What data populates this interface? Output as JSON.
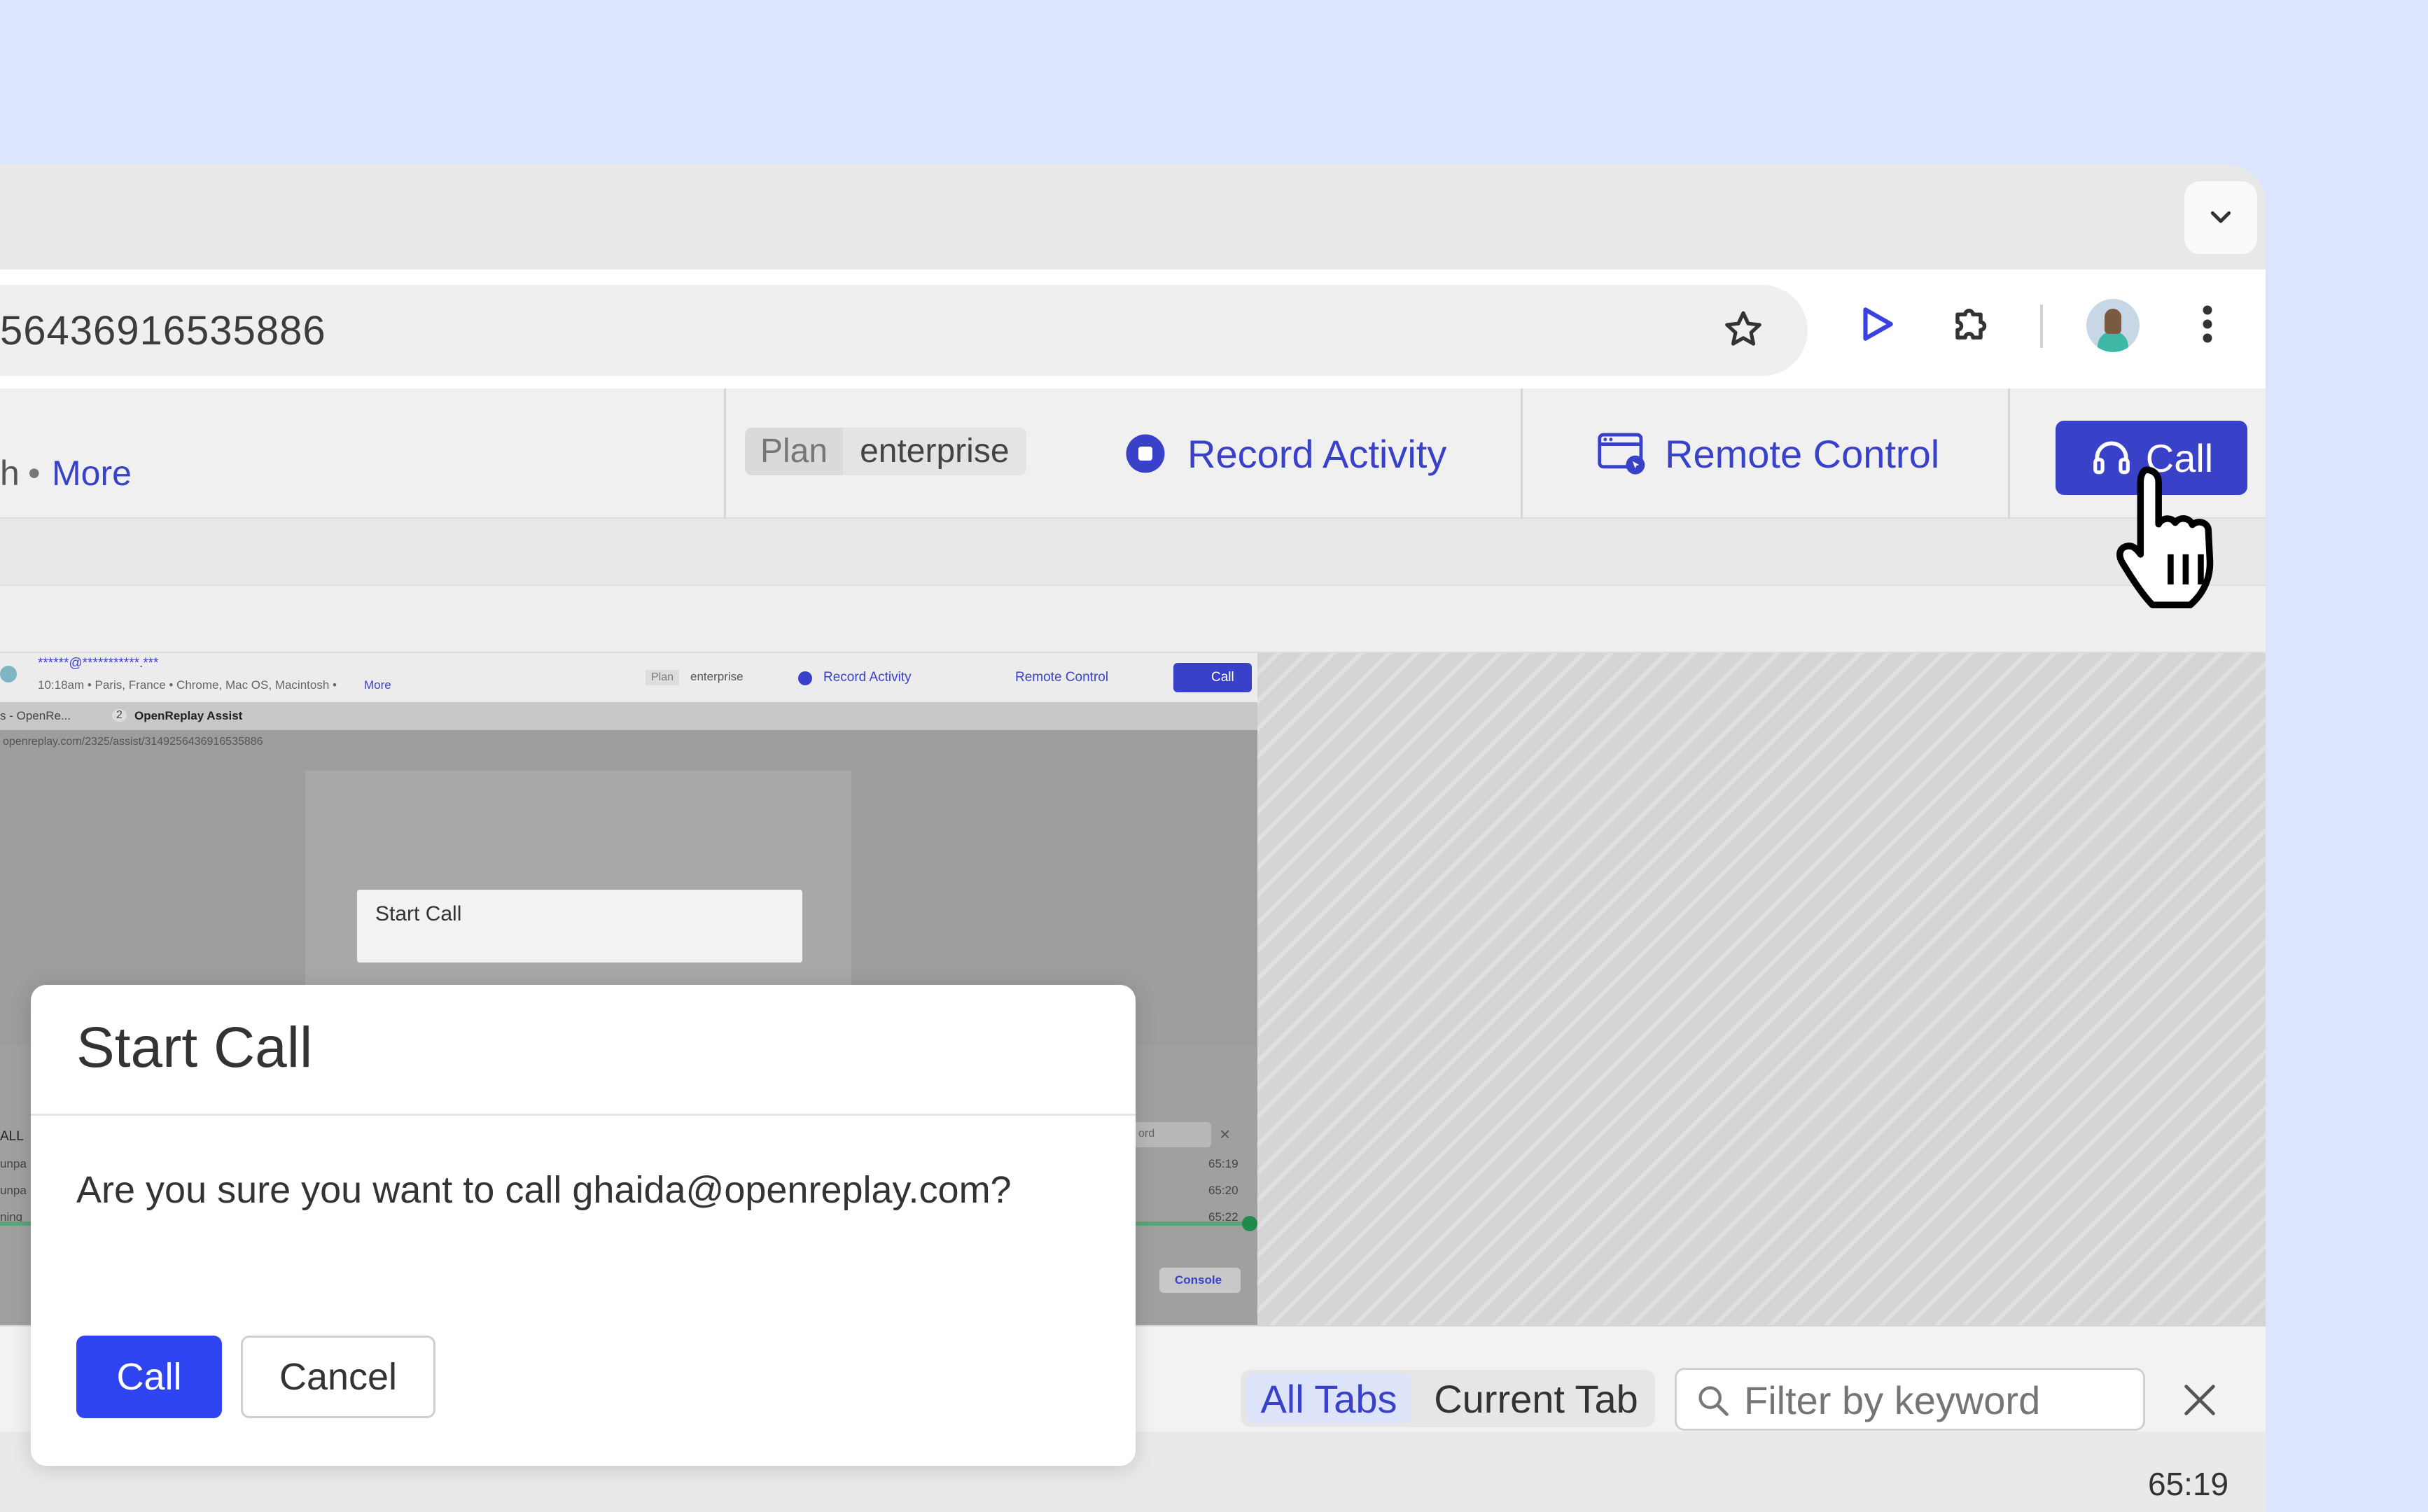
{
  "browser": {
    "url_fragment": "56436916535886",
    "tabs_dropdown_icon": "chevron-down-icon",
    "icons": [
      "star-icon",
      "play-icon",
      "puzzle-extension-icon",
      "avatar",
      "more-vert-icon"
    ]
  },
  "header": {
    "meta_suffix": "h",
    "more_link": "More",
    "plan_label": "Plan",
    "plan_value": "enterprise",
    "record_label": "Record Activity",
    "remote_label": "Remote Control",
    "call_label": "Call"
  },
  "preview": {
    "user": "******@***********.***",
    "meta": "10:18am • Paris, France • Chrome, Mac OS, Macintosh •",
    "more": "More",
    "plan_label": "Plan",
    "plan_value": "enterprise",
    "record_label": "Record Activity",
    "remote_label": "Remote Control",
    "call_label": "Call",
    "tab_one": "s - OpenRe...",
    "tab_two_num": "2",
    "tab_two": "OpenReplay Assist",
    "url": "openreplay.com/2325/assist/3149256436916535886",
    "modal_title": "Start Call",
    "all_label": "ALL",
    "rows": [
      {
        "text": "unpa",
        "time": "65:19"
      },
      {
        "text": "unpa",
        "time": "65:20"
      },
      {
        "text": "ning",
        "time": "65:22"
      }
    ],
    "filter_placeholder": "ord",
    "console_label": "Console"
  },
  "modal": {
    "title": "Start Call",
    "message": "Are you sure you want to call ghaida@openreplay.com?",
    "confirm_label": "Call",
    "cancel_label": "Cancel"
  },
  "bottom": {
    "all_tabs": "All Tabs",
    "current_tab": "Current Tab",
    "filter_placeholder": "Filter by keyword",
    "timestamp": "65:19"
  },
  "colors": {
    "accent": "#3a41c9",
    "primary_button": "#2e44f0",
    "page_background": "#dbe6fd"
  }
}
